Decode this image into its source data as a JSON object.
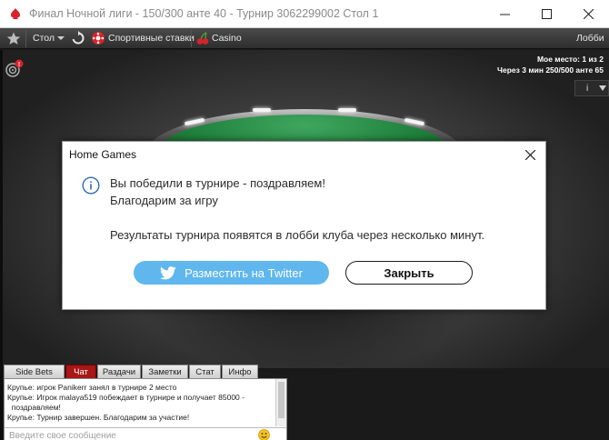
{
  "window": {
    "title": "Финал Ночной лиги - 150/300 анте 40 - Турнир 3062299002 Стол 1"
  },
  "toolbar": {
    "table_label": "Стол",
    "sports_label": "Спортивные ставки",
    "casino_label": "Casino",
    "lobby_label": "Лобби"
  },
  "table_info": {
    "place": "Мое место: 1 из 2",
    "next_level": "Через 3 мин 250/500 анте 65",
    "info_button": "i"
  },
  "dialog": {
    "title": "Home Games",
    "message_line1": "Вы победили в турнире - поздравляем!",
    "message_line2": "Благодарим за игру",
    "message_line3": "Результаты турнира появятся в лобби клуба через несколько минут.",
    "twitter_button": "Разместить на Twitter",
    "close_button": "Закрыть",
    "twitter_color": "#5fb7ee"
  },
  "chat": {
    "tabs": [
      {
        "label": "Side Bets",
        "active": false
      },
      {
        "label": "Чат",
        "active": true
      },
      {
        "label": "Раздачи",
        "active": false
      },
      {
        "label": "Заметки",
        "active": false
      },
      {
        "label": "Стат",
        "active": false
      },
      {
        "label": "Инфо",
        "active": false
      }
    ],
    "messages": [
      "Крупье: игрок Panikerr занял в турнире 2 место",
      "Крупье: Игрок malaya519 побеждает в турнире и получает 85000 -",
      "  поздравляем!",
      "Крупье: Турнир завершен. Благодарим за участие!"
    ],
    "input_placeholder": "Введите свое сообщение"
  },
  "colors": {
    "brand_red": "#d8232a",
    "felt_green": "#20823c",
    "active_tab": "#a81616"
  }
}
